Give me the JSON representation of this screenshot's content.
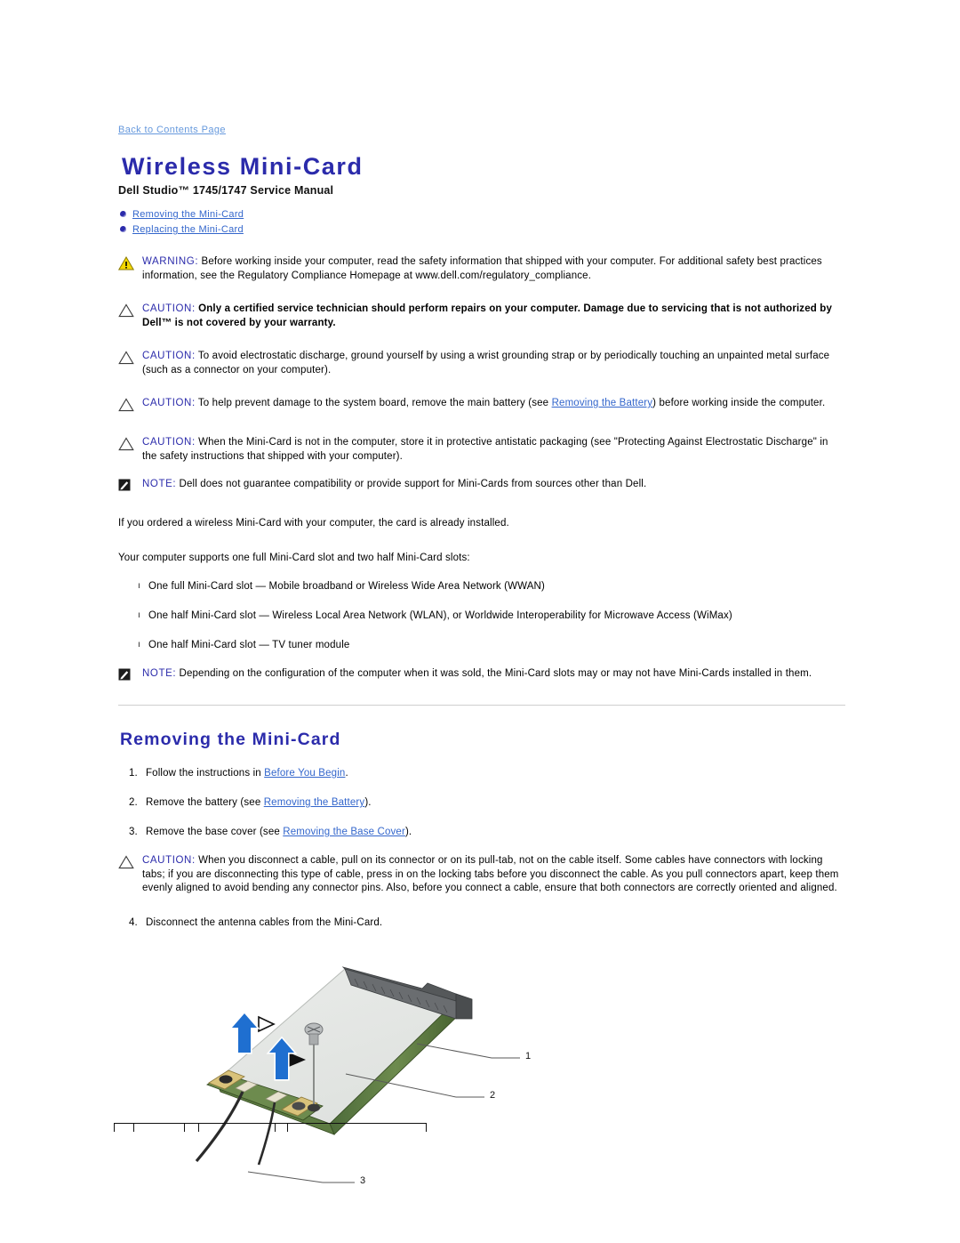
{
  "nav": {
    "back_link": "Back to Contents Page"
  },
  "header": {
    "title": "Wireless Mini-Card",
    "subtitle": "Dell Studio™ 1745/1747 Service Manual"
  },
  "toc": {
    "items": [
      {
        "label": "Removing the Mini-Card"
      },
      {
        "label": "Replacing the Mini-Card"
      }
    ]
  },
  "admonitions": {
    "warning": {
      "lead": "WARNING:",
      "text": " Before working inside your computer, read the safety information that shipped with your computer. For additional safety best practices information, see the Regulatory Compliance Homepage at www.dell.com/regulatory_compliance."
    },
    "caution_technician": {
      "lead": "CAUTION:",
      "bold_text": " Only a certified service technician should perform repairs on your computer. Damage due to servicing that is not authorized by Dell™ is not covered by your warranty."
    },
    "caution_esd": {
      "lead": "CAUTION:",
      "text": " To avoid electrostatic discharge, ground yourself by using a wrist grounding strap or by periodically touching an unpainted metal surface (such as a connector on your computer)."
    },
    "caution_battery": {
      "lead": "CAUTION:",
      "text_before": " To help prevent damage to the system board, remove the main battery (see ",
      "link": "Removing the Battery",
      "text_after": ") before working inside the computer."
    },
    "caution_storage": {
      "lead": "CAUTION:",
      "text": " When the Mini-Card is not in the computer, store it in protective antistatic packaging (see \"Protecting Against Electrostatic Discharge\" in the safety instructions that shipped with your computer)."
    },
    "note_compat": {
      "lead": "NOTE:",
      "text": " Dell does not guarantee compatibility or provide support for Mini-Cards from sources other than Dell."
    },
    "note_config": {
      "lead": "NOTE:",
      "text": " Depending on the configuration of the computer when it was sold, the Mini-Card slots may or may not have Mini-Cards installed in them."
    },
    "caution_cable": {
      "lead": "CAUTION:",
      "text": " When you disconnect a cable, pull on its connector or on its pull-tab, not on the cable itself. Some cables have connectors with locking tabs; if you are disconnecting this type of cable, press in on the locking tabs before you disconnect the cable. As you pull connectors apart, keep them evenly aligned to avoid bending any connector pins. Also, before you connect a cable, ensure that both connectors are correctly oriented and aligned."
    }
  },
  "intro": {
    "para1": "If you ordered a wireless Mini-Card with your computer, the card is already installed.",
    "para2": "Your computer supports one full Mini-Card slot and two half Mini-Card slots:",
    "slots": [
      {
        "marker": "ı",
        "text": "One full Mini-Card slot — Mobile broadband or Wireless Wide Area Network (WWAN)"
      },
      {
        "marker": "ı",
        "text": "One half Mini-Card slot — Wireless Local Area Network (WLAN), or Worldwide Interoperability for Microwave Access (WiMax)"
      },
      {
        "marker": "ı",
        "text": "One half Mini-Card slot — TV tuner module"
      }
    ]
  },
  "removing": {
    "heading": "Removing the Mini-Card",
    "steps": [
      {
        "num": "1.",
        "text_before": "Follow the instructions in ",
        "link": "Before You Begin",
        "text_after": "."
      },
      {
        "num": "2.",
        "text_before": "Remove the battery (see ",
        "link": "Removing the Battery",
        "text_after": ")."
      },
      {
        "num": "3.",
        "text_before": "Remove the base cover (see ",
        "link": "Removing the Base Cover",
        "text_after": ")."
      },
      {
        "num": "4.",
        "text_before": "Disconnect the antenna cables from the Mini-Card.",
        "link": "",
        "text_after": ""
      }
    ]
  },
  "figure": {
    "callouts": [
      {
        "id": "1"
      },
      {
        "id": "2"
      },
      {
        "id": "3"
      }
    ]
  },
  "colors": {
    "heading_blue": "#2b2bab",
    "link_blue": "#3366cc",
    "backlink_blue": "#6699dd",
    "warning_yellow": "#f5d800",
    "arrow_blue": "#1f6fd0"
  }
}
